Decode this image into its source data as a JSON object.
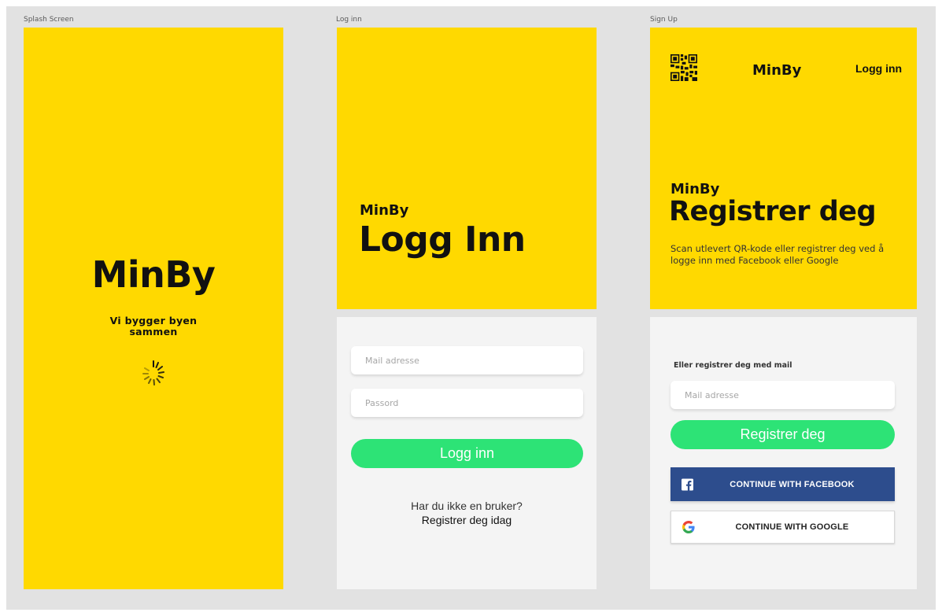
{
  "frames": {
    "splash": {
      "label": "Splash Screen",
      "title": "MinBy",
      "tagline": "Vi bygger byen sammen"
    },
    "login": {
      "label": "Log inn",
      "brand": "MinBy",
      "heading": "Logg Inn",
      "email_placeholder": "Mail adresse",
      "password_placeholder": "Passord",
      "login_button": "Logg inn",
      "no_account_text": "Har du ikke en bruker?",
      "register_link": "Registrer deg idag"
    },
    "signup": {
      "label": "Sign Up",
      "topbar_title": "MinBy",
      "topbar_login": "Logg inn",
      "brand": "MinBy",
      "heading": "Registrer deg",
      "description": "Scan utlevert QR-kode eller  registrer deg ved å logge inn med Facebook eller Google",
      "mail_label": "Eller registrer deg med mail",
      "email_placeholder": "Mail adresse",
      "register_button": "Registrer deg",
      "facebook_button": "CONTINUE WITH FACEBOOK",
      "google_button": "CONTINUE WITH GOOGLE"
    }
  },
  "icons": {
    "spinner": "loading-spinner-icon",
    "qr": "qr-code-icon",
    "facebook": "facebook-icon",
    "google": "google-icon"
  },
  "colors": {
    "brand_yellow": "#ffd900",
    "accent_green": "#2de376",
    "facebook_blue": "#2d4d8d",
    "panel_gray": "#f4f4f4",
    "canvas_gray": "#e2e2e2"
  }
}
